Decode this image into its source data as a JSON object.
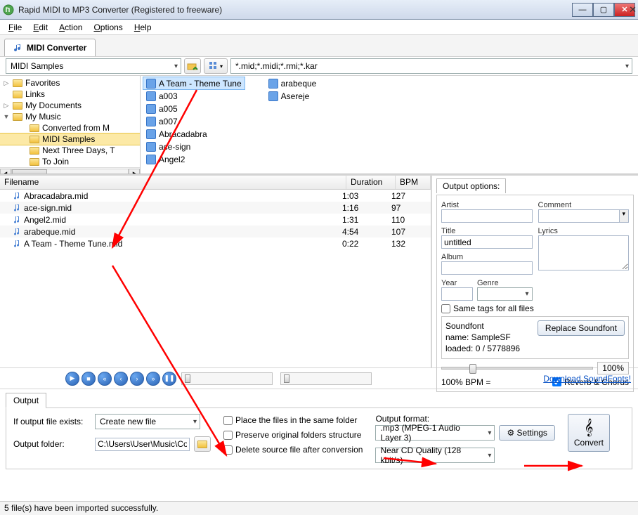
{
  "window": {
    "title": "Rapid MIDI to MP3 Converter (Registered to freeware)"
  },
  "menu": {
    "file": "File",
    "edit": "Edit",
    "action": "Action",
    "options": "Options",
    "help": "Help"
  },
  "tab": {
    "label": "MIDI Converter"
  },
  "toolbar": {
    "folder": "MIDI Samples",
    "filter": "*.mid;*.midi;*.rmi;*.kar"
  },
  "tree": {
    "items": [
      {
        "label": "Favorites",
        "indent": 0,
        "tri": "▷"
      },
      {
        "label": "Links",
        "indent": 0,
        "tri": ""
      },
      {
        "label": "My Documents",
        "indent": 0,
        "tri": "▷"
      },
      {
        "label": "My Music",
        "indent": 0,
        "tri": "▼"
      },
      {
        "label": "Converted from M",
        "indent": 1,
        "tri": ""
      },
      {
        "label": "MIDI Samples",
        "indent": 1,
        "tri": "",
        "sel": true
      },
      {
        "label": "Next Three Days, T",
        "indent": 1,
        "tri": ""
      },
      {
        "label": "To Join",
        "indent": 1,
        "tri": ""
      }
    ]
  },
  "files": [
    [
      "A Team - Theme Tune",
      "a003",
      "a005",
      "a007",
      "Abracadabra",
      "ace-sign",
      "Angel2"
    ],
    [
      "arabeque",
      "Asereje"
    ]
  ],
  "queue": {
    "headers": {
      "fn": "Filename",
      "dur": "Duration",
      "bpm": "BPM"
    },
    "rows": [
      {
        "fn": "Abracadabra.mid",
        "dur": "1:03",
        "bpm": "127"
      },
      {
        "fn": "ace-sign.mid",
        "dur": "1:16",
        "bpm": "97"
      },
      {
        "fn": "Angel2.mid",
        "dur": "1:31",
        "bpm": "110"
      },
      {
        "fn": "arabeque.mid",
        "dur": "4:54",
        "bpm": "107"
      },
      {
        "fn": "A Team - Theme Tune.mid",
        "dur": "0:22",
        "bpm": "132"
      }
    ]
  },
  "options": {
    "tab": "Output options:",
    "artist": "Artist",
    "comment": "Comment",
    "title": "Title",
    "titleVal": "untitled",
    "album": "Album",
    "lyrics": "Lyrics",
    "year": "Year",
    "genre": "Genre",
    "sametags": "Same tags for all files",
    "sfLabel": "Soundfont",
    "sfName": "name: SampleSF",
    "sfLoaded": "loaded: 0 / 5778896",
    "replace": "Replace Soundfont",
    "vol": "100%",
    "bpmlabel": "100%    BPM =",
    "reverb": "Reverb & Chorus"
  },
  "player": {
    "link": "Download SoundFonts!"
  },
  "output": {
    "tab": "Output",
    "ifexists": "If output file exists:",
    "ifexistsVal": "Create new file",
    "folder": "Output folder:",
    "folderVal": "C:\\Users\\User\\Music\\Converte",
    "opt1": "Place the files in the same folder",
    "opt2": "Preserve original folders structure",
    "opt3": "Delete source file after conversion",
    "fmt": "Output format:",
    "fmtVal": ".mp3 (MPEG-1 Audio Layer 3)",
    "quality": "Near CD Quality (128 kbit/s)",
    "settings": "Settings",
    "convert": "Convert"
  },
  "status": "5 file(s) have been imported successfully."
}
